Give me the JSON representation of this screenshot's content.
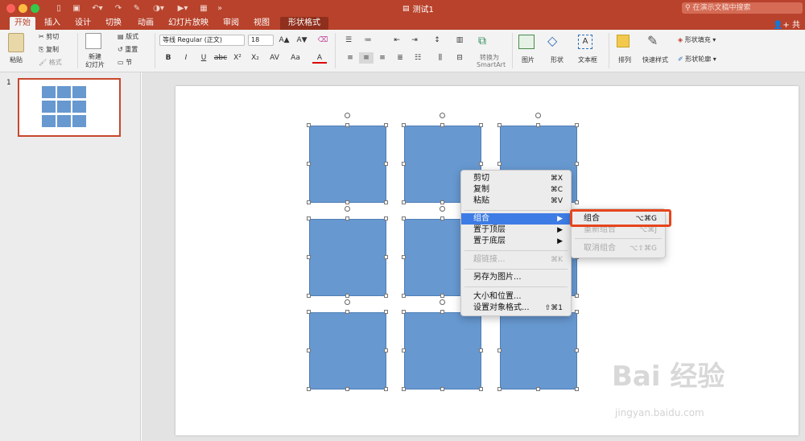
{
  "window": {
    "title": "测试1",
    "search_placeholder": "在演示文稿中搜索",
    "share": "共"
  },
  "tabs": [
    "开始",
    "插入",
    "设计",
    "切换",
    "动画",
    "幻灯片放映",
    "审阅",
    "视图",
    "形状格式"
  ],
  "ribbon": {
    "paste": "粘贴",
    "cut": "剪切",
    "copy": "复制",
    "format": "格式",
    "new_slide_1": "新建",
    "new_slide_2": "幻灯片",
    "layout": "版式",
    "reset": "重置",
    "section": "节",
    "font_name": "等线 Regular (正文)",
    "font_size": "18",
    "bold": "B",
    "italic": "I",
    "underline": "U",
    "strike": "abc",
    "superscript": "X²",
    "subscript": "X₂",
    "char_spacing": "AV",
    "change_case": "Aa",
    "font_color": "A",
    "smartart_1": "转换为",
    "smartart_2": "SmartArt",
    "picture": "图片",
    "shape": "形状",
    "textbox": "文本框",
    "arrange": "排列",
    "quick_styles": "快速样式",
    "shape_fill": "形状填充",
    "shape_outline": "形状轮廓"
  },
  "slide_panel": {
    "number": "1"
  },
  "context_menu": {
    "items": [
      {
        "label": "剪切",
        "shortcut": "⌘X"
      },
      {
        "label": "复制",
        "shortcut": "⌘C"
      },
      {
        "label": "粘贴",
        "shortcut": "⌘V"
      },
      {
        "label": "组合",
        "shortcut": "▶"
      },
      {
        "label": "置于顶层",
        "shortcut": "▶"
      },
      {
        "label": "置于底层",
        "shortcut": "▶"
      },
      {
        "label": "超链接...",
        "shortcut": "⌘K"
      },
      {
        "label": "另存为图片..."
      },
      {
        "label": "大小和位置..."
      },
      {
        "label": "设置对象格式...",
        "shortcut": "⇧⌘1"
      }
    ]
  },
  "submenu": {
    "items": [
      {
        "label": "组合",
        "shortcut": "⌥⌘G"
      },
      {
        "label": "重新组合",
        "shortcut": "⌥⌘J"
      },
      {
        "label": "取消组合",
        "shortcut": "⌥⇧⌘G"
      }
    ]
  },
  "watermark": {
    "brand": "Bai 经验",
    "url": "jingyan.baidu.com"
  },
  "colors": {
    "accent": "#b8422b",
    "shape_fill": "#6798d0",
    "menu_selected": "#3d7ce4",
    "highlight": "#e6451c"
  }
}
